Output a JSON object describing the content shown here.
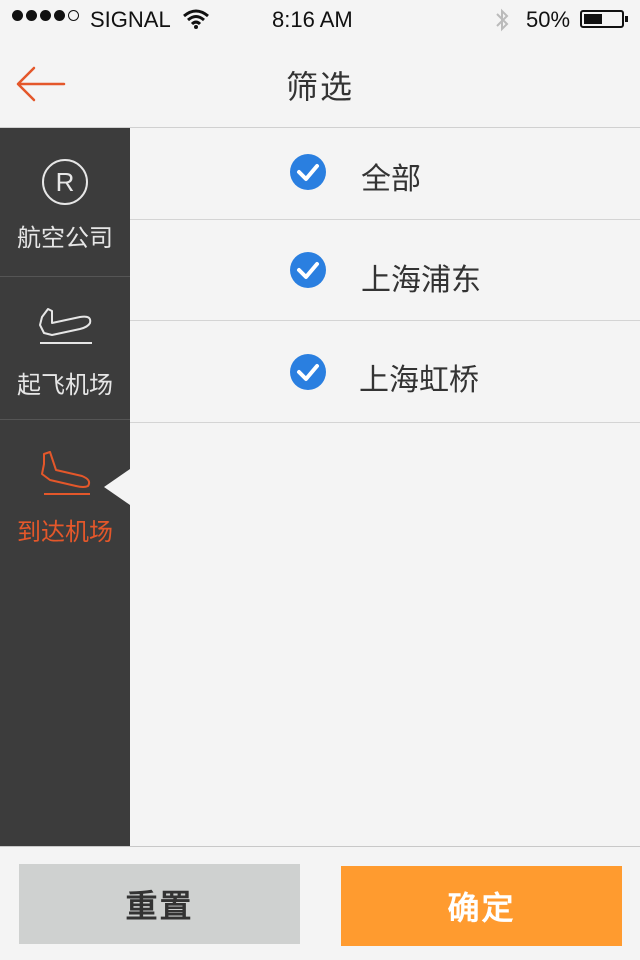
{
  "status_bar": {
    "carrier": "SIGNAL",
    "time": "8:16 AM",
    "battery": "50%",
    "battery_level": 0.5
  },
  "header": {
    "title": "筛选",
    "back_icon": "arrow-left-icon"
  },
  "sidebar": {
    "items": [
      {
        "label": "航空公司",
        "icon": "registered-icon",
        "active": false
      },
      {
        "label": "起飞机场",
        "icon": "departure-plane-icon",
        "active": false
      },
      {
        "label": "到达机场",
        "icon": "arrival-plane-icon",
        "active": true
      }
    ]
  },
  "options": [
    {
      "label": "全部",
      "checked": true
    },
    {
      "label": "上海浦东",
      "checked": true
    },
    {
      "label": "上海虹桥",
      "checked": true
    }
  ],
  "buttons": {
    "reset": "重置",
    "confirm": "确定"
  },
  "colors": {
    "accent": "#e4572a",
    "confirm": "#ff9b2f",
    "check": "#2a7fe0",
    "sidebar": "#3c3c3c"
  }
}
